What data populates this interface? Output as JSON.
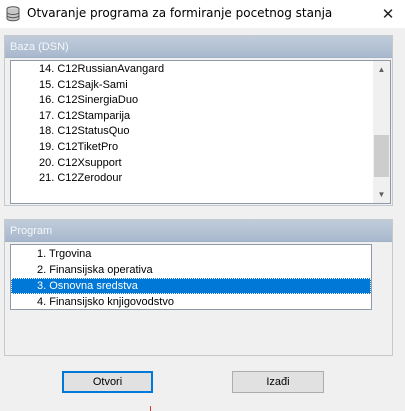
{
  "window": {
    "title": "Otvaranje programa za formiranje pocetnog stanja",
    "close_glyph": "✕",
    "icon": "database-icon"
  },
  "database_group": {
    "header": "Baza (DSN)",
    "items": [
      {
        "label": "14. C12RussianAvangard"
      },
      {
        "label": "15. C12Sajk-Sami"
      },
      {
        "label": "16. C12SinergiaDuo"
      },
      {
        "label": "17. C12Stamparija"
      },
      {
        "label": "18. C12StatusQuo"
      },
      {
        "label": "19. C12TiketPro"
      },
      {
        "label": "20. C12Xsupport"
      },
      {
        "label": "21. C12Zerodour"
      }
    ],
    "scroll_position": 0.86
  },
  "program_group": {
    "header": "Program",
    "items": [
      {
        "label": "1. Trgovina",
        "selected": false
      },
      {
        "label": "2. Finansijska operativa",
        "selected": false
      },
      {
        "label": "3. Osnovna sredstva",
        "selected": true
      },
      {
        "label": "4. Finansijsko knjigovodstvo",
        "selected": false
      }
    ]
  },
  "buttons": {
    "ok_label": "Otvori",
    "exit_label": "Izađi"
  },
  "colors": {
    "selection": "#0078d7",
    "group_header": "#a8b8cd",
    "default_button_border": "#0078d7"
  }
}
